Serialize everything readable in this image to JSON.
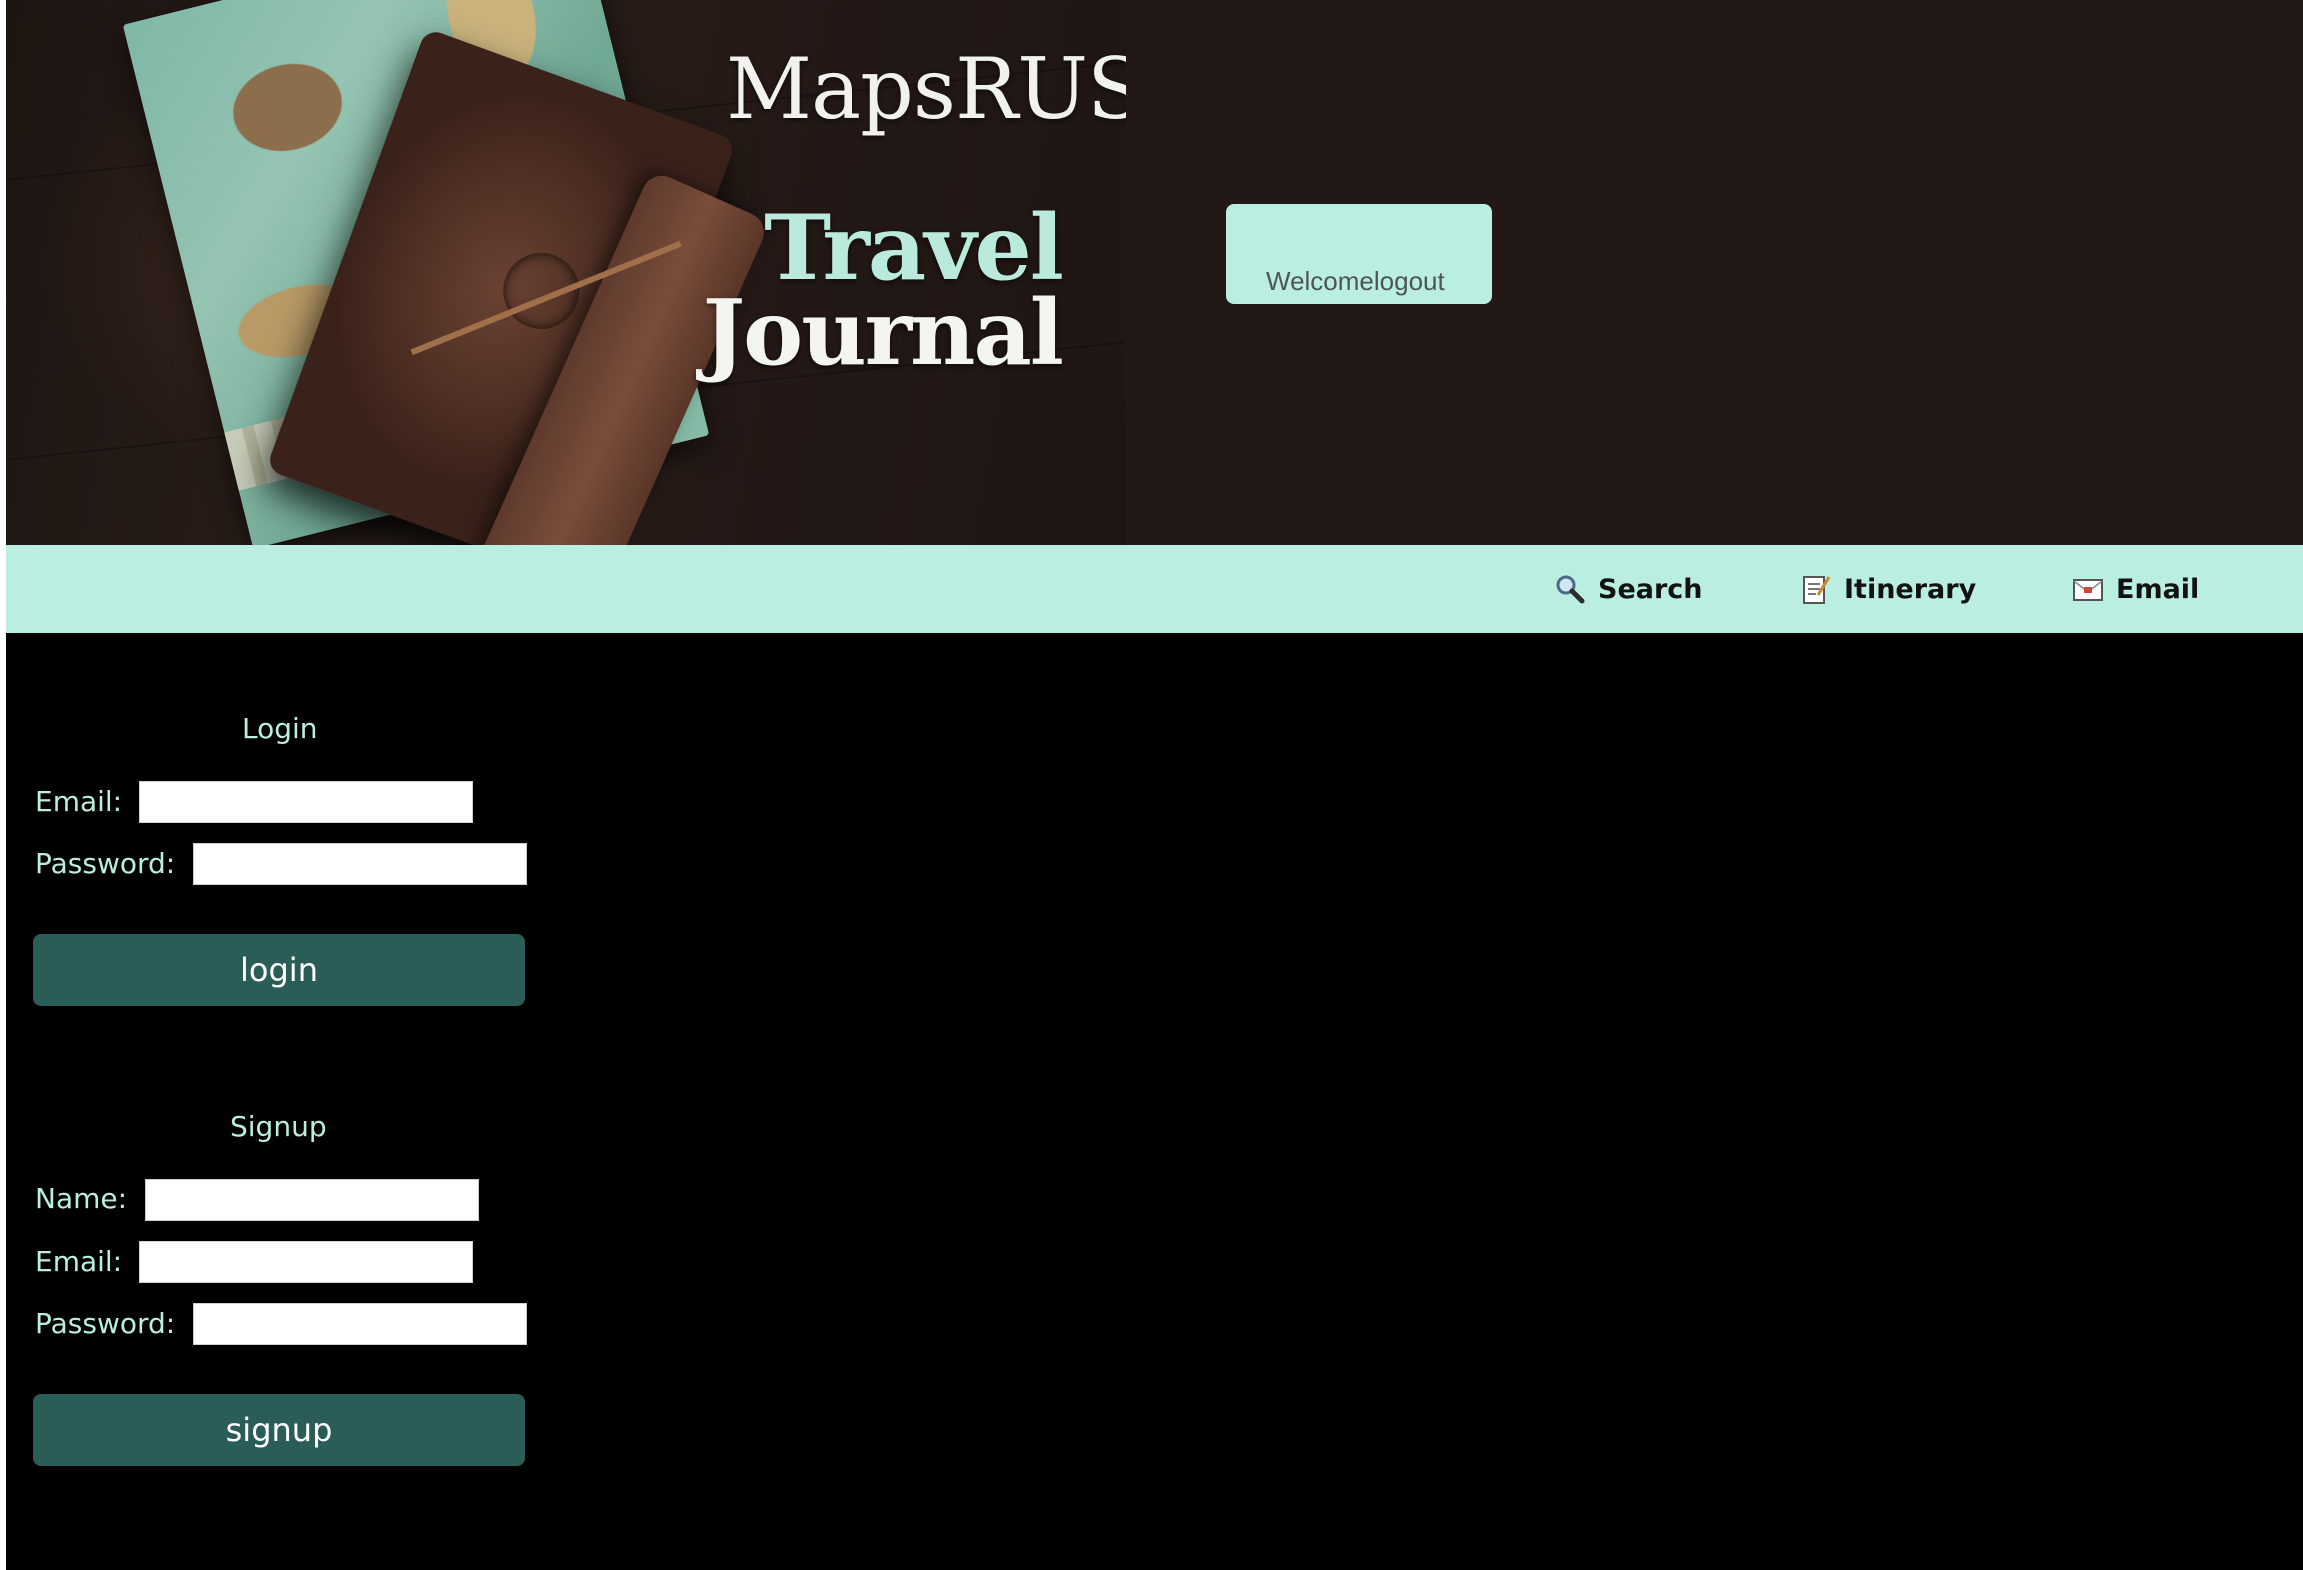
{
  "header": {
    "brand": "MapsRUS",
    "title_line1": "Travel",
    "title_line2": "Journal",
    "welcome_text": "Welcomelogout"
  },
  "nav": {
    "items": [
      {
        "label": "Search",
        "icon": "search-icon"
      },
      {
        "label": "Itinerary",
        "icon": "itinerary-icon"
      },
      {
        "label": "Email",
        "icon": "email-icon"
      }
    ]
  },
  "login": {
    "title": "Login",
    "email_label": "Email:",
    "email_value": "",
    "password_label": "Password:",
    "password_value": "",
    "button_label": "login"
  },
  "signup": {
    "title": "Signup",
    "name_label": "Name:",
    "name_value": "",
    "email_label": "Email:",
    "email_value": "",
    "password_label": "Password:",
    "password_value": "",
    "button_label": "signup"
  },
  "colors": {
    "accent": "#b9eee0",
    "button": "#2a5d58",
    "background": "#000000",
    "header_bg": "#221917"
  }
}
